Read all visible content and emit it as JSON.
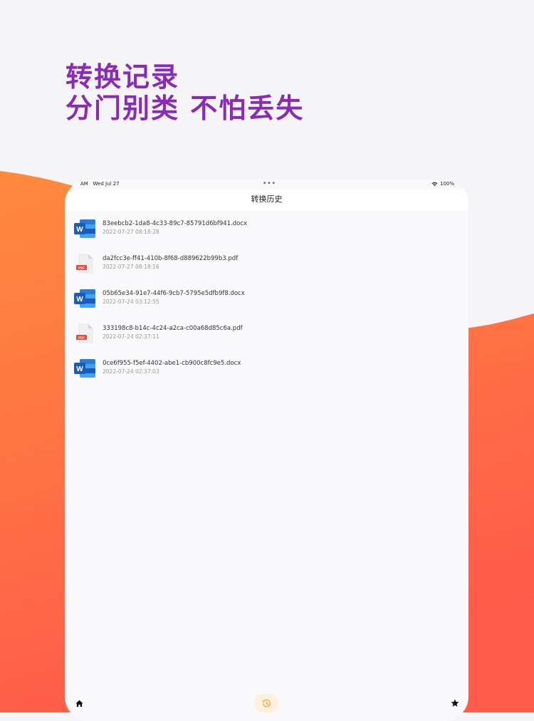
{
  "headline": {
    "line1": "转换记录",
    "line2": "分门别类 不怕丢失"
  },
  "colors": {
    "headline": "#8a2ab8",
    "wave_top": "#ff8a3d",
    "wave_bottom": "#ff5b4a",
    "history_tab_bg": "#fdf0dc",
    "history_tab_icon": "#f2a93b"
  },
  "status_bar": {
    "time": "AM",
    "date": "Wed Jul 27",
    "battery": "100%"
  },
  "nav": {
    "title": "转换历史"
  },
  "files": [
    {
      "name": "83eebcb2-1da8-4c33-89c7-85791d6bf941.docx",
      "date": "2022-07-27 08:18:28",
      "type": "word-icon"
    },
    {
      "name": "da2fcc3e-ff41-410b-8f68-d889622b99b3.pdf",
      "date": "2022-07-27 08:18:16",
      "type": "pdf-icon"
    },
    {
      "name": "05b65e34-91e7-44f6-9cb7-5795e5dfb9f8.docx",
      "date": "2022-07-24 03:12:55",
      "type": "word-icon"
    },
    {
      "name": "333198c8-b14c-4c24-a2ca-c00a68d85c6a.pdf",
      "date": "2022-07-24 02:37:11",
      "type": "pdf-icon"
    },
    {
      "name": "0ce6f955-f5ef-4402-abe1-cb900c8fc9e5.docx",
      "date": "2022-07-24 02:37:03",
      "type": "word-icon"
    }
  ],
  "icons": {
    "word_letter": "W",
    "pdf_label": "PDF"
  },
  "tabs": [
    {
      "icon": "home-icon"
    },
    {
      "icon": "history-icon"
    },
    {
      "icon": "star-icon"
    }
  ]
}
